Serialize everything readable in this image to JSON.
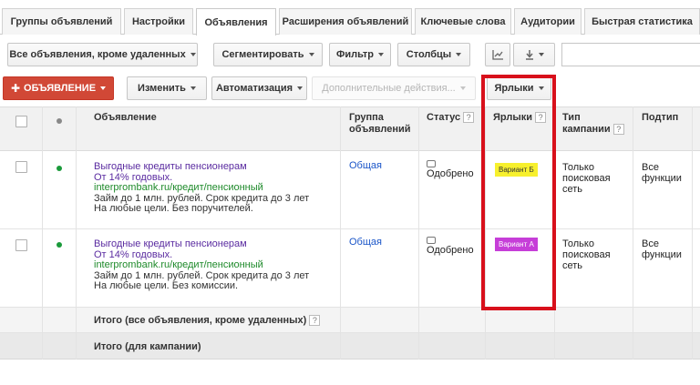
{
  "tabs": [
    "Группы объявлений",
    "Настройки",
    "Объявления",
    "Расширения объявлений",
    "Ключевые слова",
    "Аудитории",
    "Быстрая статистика"
  ],
  "toolbar": {
    "filter_view": "Все объявления, кроме удаленных",
    "segment": "Сегментировать",
    "filter": "Фильтр",
    "columns": "Столбцы",
    "chart_icon": "line-chart-icon",
    "download_icon": "download-icon",
    "add_ad": "ОБЪЯВЛЕНИЕ",
    "edit": "Изменить",
    "automation": "Автоматизация",
    "more_actions": "Дополнительные действия...",
    "labels": "Ярлыки"
  },
  "table": {
    "headers": {
      "ad": "Объявление",
      "ad_group": "Группа объявлений",
      "status": "Статус",
      "labels": "Ярлыки",
      "campaign_type": "Тип кампании",
      "subtype": "Подтип",
      "help": "?"
    },
    "rows": [
      {
        "title": "Выгодные кредиты пенсионерам",
        "line2": "От 14% годовых.",
        "url": "interprombank.ru/кредит/пенсионный",
        "line3": "Займ до 1 млн. рублей. Срок кредита до 3 лет",
        "line4": "На любые цели. Без поручителей.",
        "ad_group": "Общая",
        "status": "Одобрено",
        "label": "Вариант Б",
        "label_color": "#f7f02d",
        "campaign_type": "Только поисковая сеть",
        "subtype": "Все функции"
      },
      {
        "title": "Выгодные кредиты пенсионерам",
        "line2": "От 14% годовых.",
        "url": "interprombank.ru/кредит/пенсионный",
        "line3": "Займ до 1 млн. рублей. Срок кредита до 3 лет",
        "line4": "На любые цели. Без комиссии.",
        "ad_group": "Общая",
        "status": "Одобрено",
        "label": "Вариант А",
        "label_color": "#c63ed8",
        "campaign_type": "Только поисковая сеть",
        "subtype": "Все функции"
      }
    ],
    "total_filtered": "Итого (все объявления, кроме удаленных)",
    "total_campaign": "Итого (для кампании)"
  },
  "colors": {
    "accent_red": "#d14836",
    "highlight": "#d8101b",
    "status_dot": "#1a9a3a"
  }
}
